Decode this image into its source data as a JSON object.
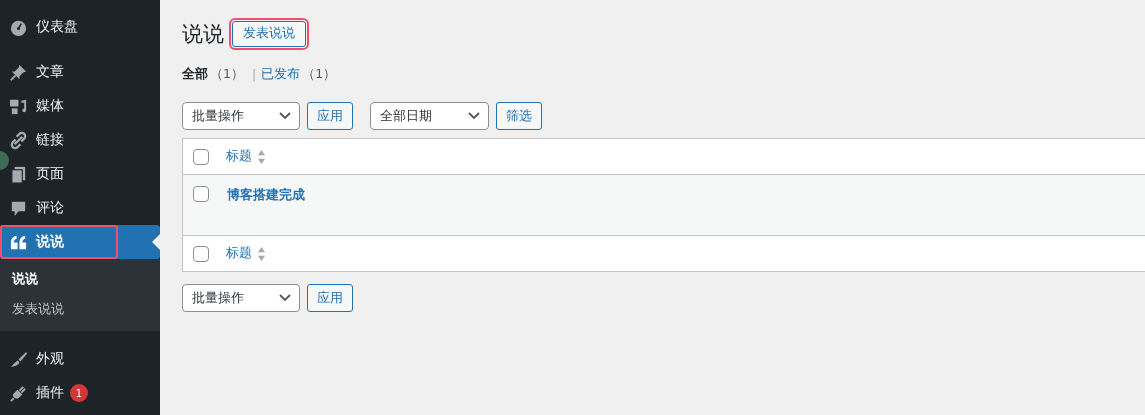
{
  "sidebar": {
    "groups": [
      [
        {
          "label": "仪表盘",
          "selected": false,
          "highlighted": false
        }
      ],
      [
        {
          "label": "文章",
          "selected": false,
          "highlighted": false
        },
        {
          "label": "媒体",
          "selected": false,
          "highlighted": false
        },
        {
          "label": "链接",
          "selected": false,
          "highlighted": false
        },
        {
          "label": "页面",
          "selected": false,
          "highlighted": false
        },
        {
          "label": "评论",
          "selected": false,
          "highlighted": false
        },
        {
          "label": "说说",
          "selected": true,
          "highlighted": true,
          "children": [
            {
              "label": "说说",
              "selected": true
            },
            {
              "label": "发表说说",
              "selected": false
            }
          ]
        }
      ],
      [
        {
          "label": "外观",
          "selected": false,
          "highlighted": false
        },
        {
          "label": "插件",
          "selected": false,
          "highlighted": false,
          "badge": "1"
        }
      ]
    ]
  },
  "page": {
    "title": "说说",
    "add_button": {
      "label": "发表说说",
      "highlighted": true
    },
    "views": [
      {
        "label": "全部",
        "count": "（1）",
        "selected": true
      },
      {
        "separator": "|",
        "label": "已发布",
        "count": "（1）",
        "selected": false
      }
    ],
    "top_actions": {
      "bulk": "批量操作",
      "apply": "应用",
      "date": "全部日期",
      "filter": "筛选"
    },
    "table": {
      "header": {
        "column": "标题",
        "checked": false
      },
      "rows": [
        {
          "title": "博客搭建完成",
          "checked": false
        }
      ],
      "footer": {
        "column": "标题",
        "checked": false
      }
    },
    "bottom_actions": {
      "bulk": "批量操作",
      "apply": "应用"
    }
  }
}
